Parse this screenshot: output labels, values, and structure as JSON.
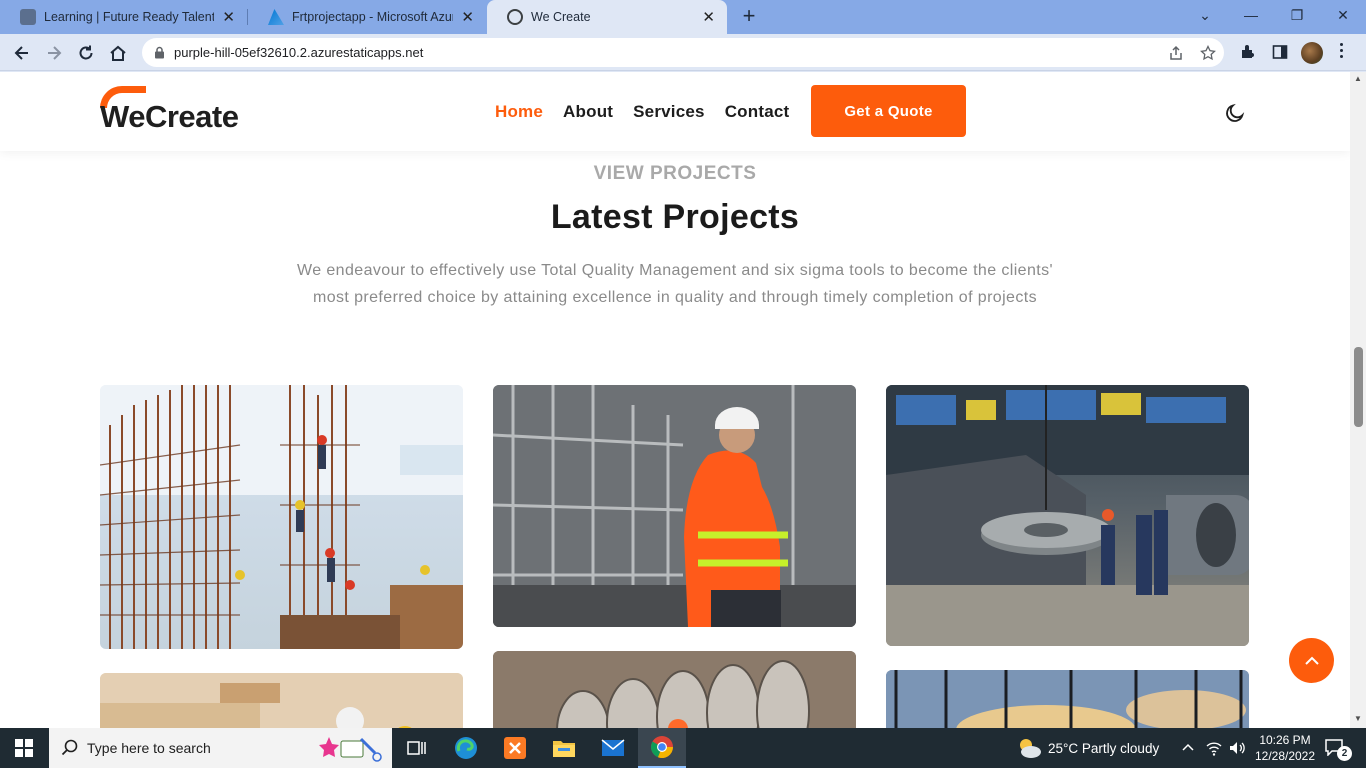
{
  "browser": {
    "tabs": [
      {
        "title": "Learning | Future Ready Talent",
        "active": false,
        "favicon_color": "#5b6f8e"
      },
      {
        "title": "Frtprojectapp - Microsoft Azure",
        "active": false,
        "favicon_color": "#1e6fd0"
      },
      {
        "title": "We Create",
        "active": true,
        "favicon_color": "#3c4043"
      }
    ],
    "url": "purple-hill-05ef32610.2.azurestaticapps.net"
  },
  "site": {
    "brand": "WeCreate",
    "nav": [
      {
        "label": "Home",
        "active": true
      },
      {
        "label": "About",
        "active": false
      },
      {
        "label": "Services",
        "active": false
      },
      {
        "label": "Contact",
        "active": false
      }
    ],
    "cta_label": "Get a Quote",
    "accent_color": "#fd5c0c"
  },
  "projects": {
    "eyebrow": "VIEW PROJECTS",
    "title": "Latest Projects",
    "description": "We endeavour to effectively use Total Quality Management and six sigma tools to become the clients' most preferred choice by attaining excellence in quality and through timely completion of projects"
  },
  "taskbar": {
    "search_placeholder": "Type here to search",
    "weather": "25°C  Partly cloudy",
    "time": "10:26 PM",
    "date": "12/28/2022",
    "notifications": "2"
  }
}
